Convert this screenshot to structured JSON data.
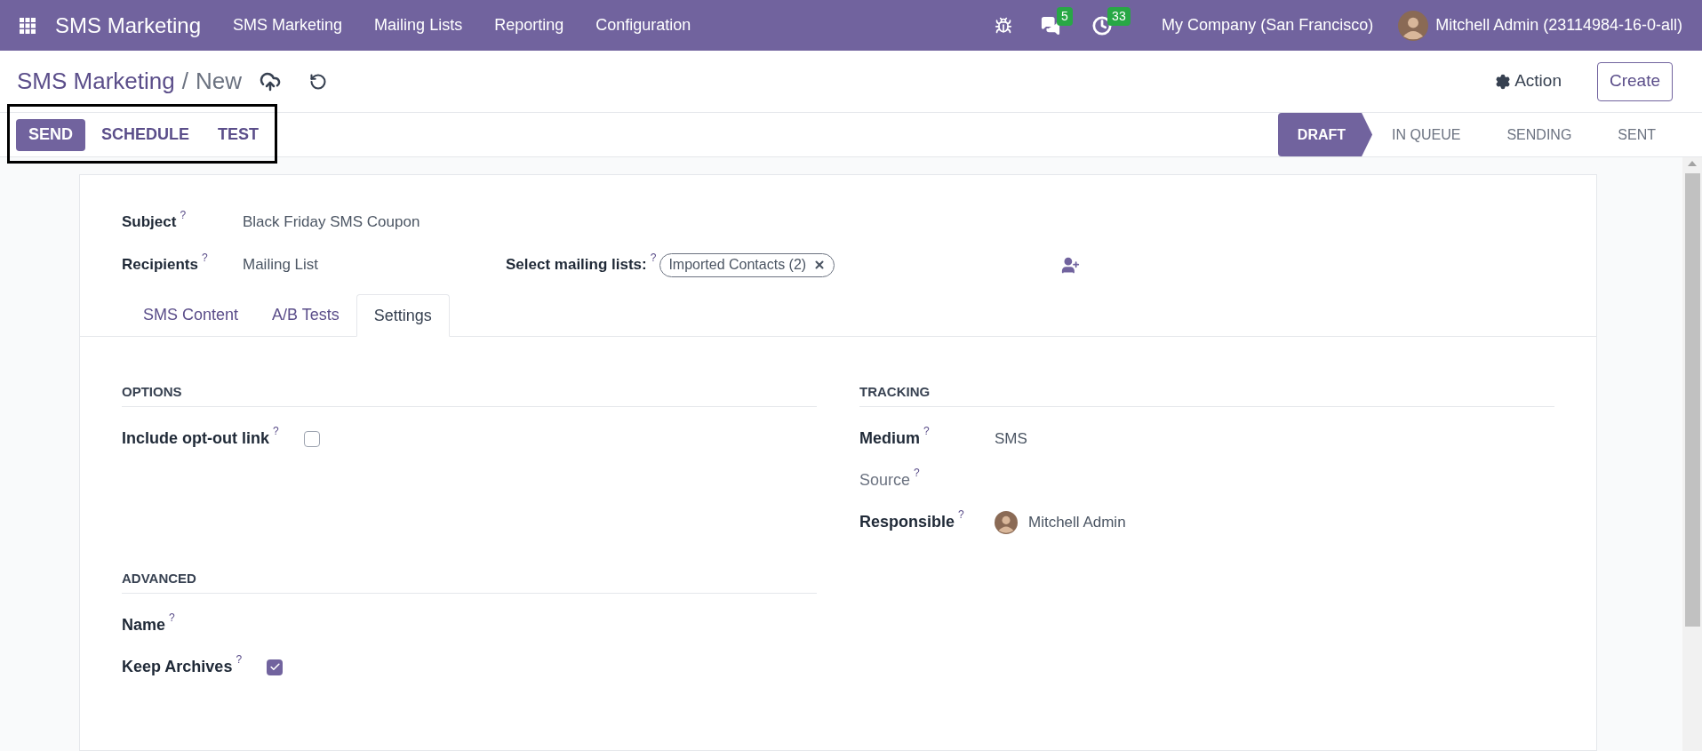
{
  "navbar": {
    "brand": "SMS Marketing",
    "menu": [
      "SMS Marketing",
      "Mailing Lists",
      "Reporting",
      "Configuration"
    ],
    "messages_badge": "5",
    "activities_badge": "33",
    "company": "My Company (San Francisco)",
    "user": "Mitchell Admin (23114984-16-0-all)"
  },
  "breadcrumb": {
    "parent": "SMS Marketing",
    "separator": "/",
    "current": "New"
  },
  "action_button": "Action",
  "create_button": "Create",
  "header_buttons": [
    {
      "label": "SEND",
      "primary": true
    },
    {
      "label": "SCHEDULE",
      "primary": false
    },
    {
      "label": "TEST",
      "primary": false
    }
  ],
  "stages": [
    {
      "label": "DRAFT",
      "selected": true
    },
    {
      "label": "IN QUEUE",
      "selected": false
    },
    {
      "label": "SENDING",
      "selected": false
    },
    {
      "label": "SENT",
      "selected": false
    }
  ],
  "form": {
    "subject": {
      "label": "Subject",
      "help": "?",
      "value": "Black Friday SMS Coupon"
    },
    "recipients": {
      "label": "Recipients",
      "help": "?",
      "value": "Mailing List"
    },
    "mailing_lists": {
      "label": "Select mailing lists:",
      "help": "?",
      "tags": [
        "Imported Contacts (2)"
      ]
    }
  },
  "tabs": [
    {
      "label": "SMS Content",
      "selected": false
    },
    {
      "label": "A/B Tests",
      "selected": false
    },
    {
      "label": "Settings",
      "selected": true
    }
  ],
  "settings_rows": [
    [
      {
        "title": "OPTIONS",
        "fields": [
          {
            "kind": "checkbox",
            "label": "Include opt-out link",
            "help": "?",
            "muted": false,
            "checked": false
          }
        ]
      },
      {
        "title": "TRACKING",
        "fields": [
          {
            "kind": "text",
            "label": "Medium",
            "help": "?",
            "muted": false,
            "value": "SMS"
          },
          {
            "kind": "empty",
            "label": "Source",
            "help": "?",
            "muted": true
          },
          {
            "kind": "user",
            "label": "Responsible",
            "help": "?",
            "muted": false,
            "value": "Mitchell Admin"
          }
        ]
      }
    ],
    [
      {
        "title": "ADVANCED",
        "fields": [
          {
            "kind": "empty",
            "label": "Name",
            "help": "?",
            "muted": false
          },
          {
            "kind": "checkbox",
            "label": "Keep Archives",
            "help": "?",
            "muted": false,
            "checked": true
          }
        ]
      }
    ]
  ]
}
